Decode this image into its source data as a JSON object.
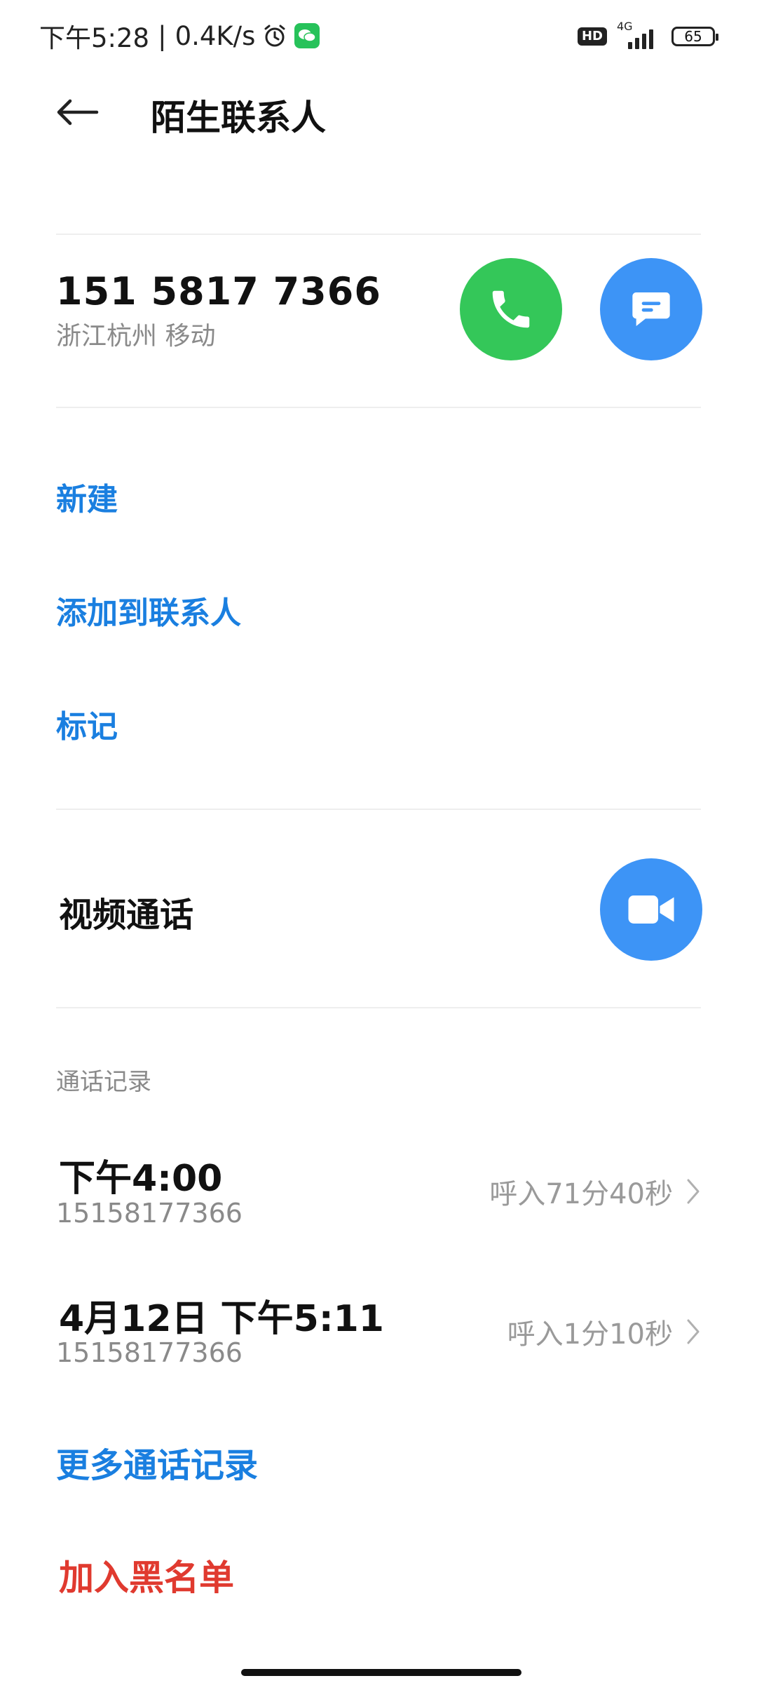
{
  "status_bar": {
    "time": "下午5:28",
    "speed": "0.4K/s",
    "hd": "HD",
    "network": "4G",
    "battery": "65",
    "icons": [
      "alarm-icon",
      "wechat-icon",
      "signal-icon",
      "battery-icon"
    ]
  },
  "header": {
    "title": "陌生联系人"
  },
  "contact": {
    "number": "151 5817 7366",
    "location": "浙江杭州 移动"
  },
  "actions": {
    "new": "新建",
    "add_to_contacts": "添加到联系人",
    "mark": "标记"
  },
  "video_call": {
    "label": "视频通话"
  },
  "call_log": {
    "title": "通话记录",
    "entries": [
      {
        "time": "下午4:00",
        "number": "15158177366",
        "detail": "呼入71分40秒"
      },
      {
        "time": "4月12日 下午5:11",
        "number": "15158177366",
        "detail": "呼入1分10秒"
      }
    ],
    "more": "更多通话记录"
  },
  "blacklist": {
    "label": "加入黑名单"
  },
  "colors": {
    "accent_blue": "#1a7fe0",
    "call_green": "#34c759",
    "circle_blue": "#3d94f6",
    "danger_red": "#e03a2f"
  }
}
